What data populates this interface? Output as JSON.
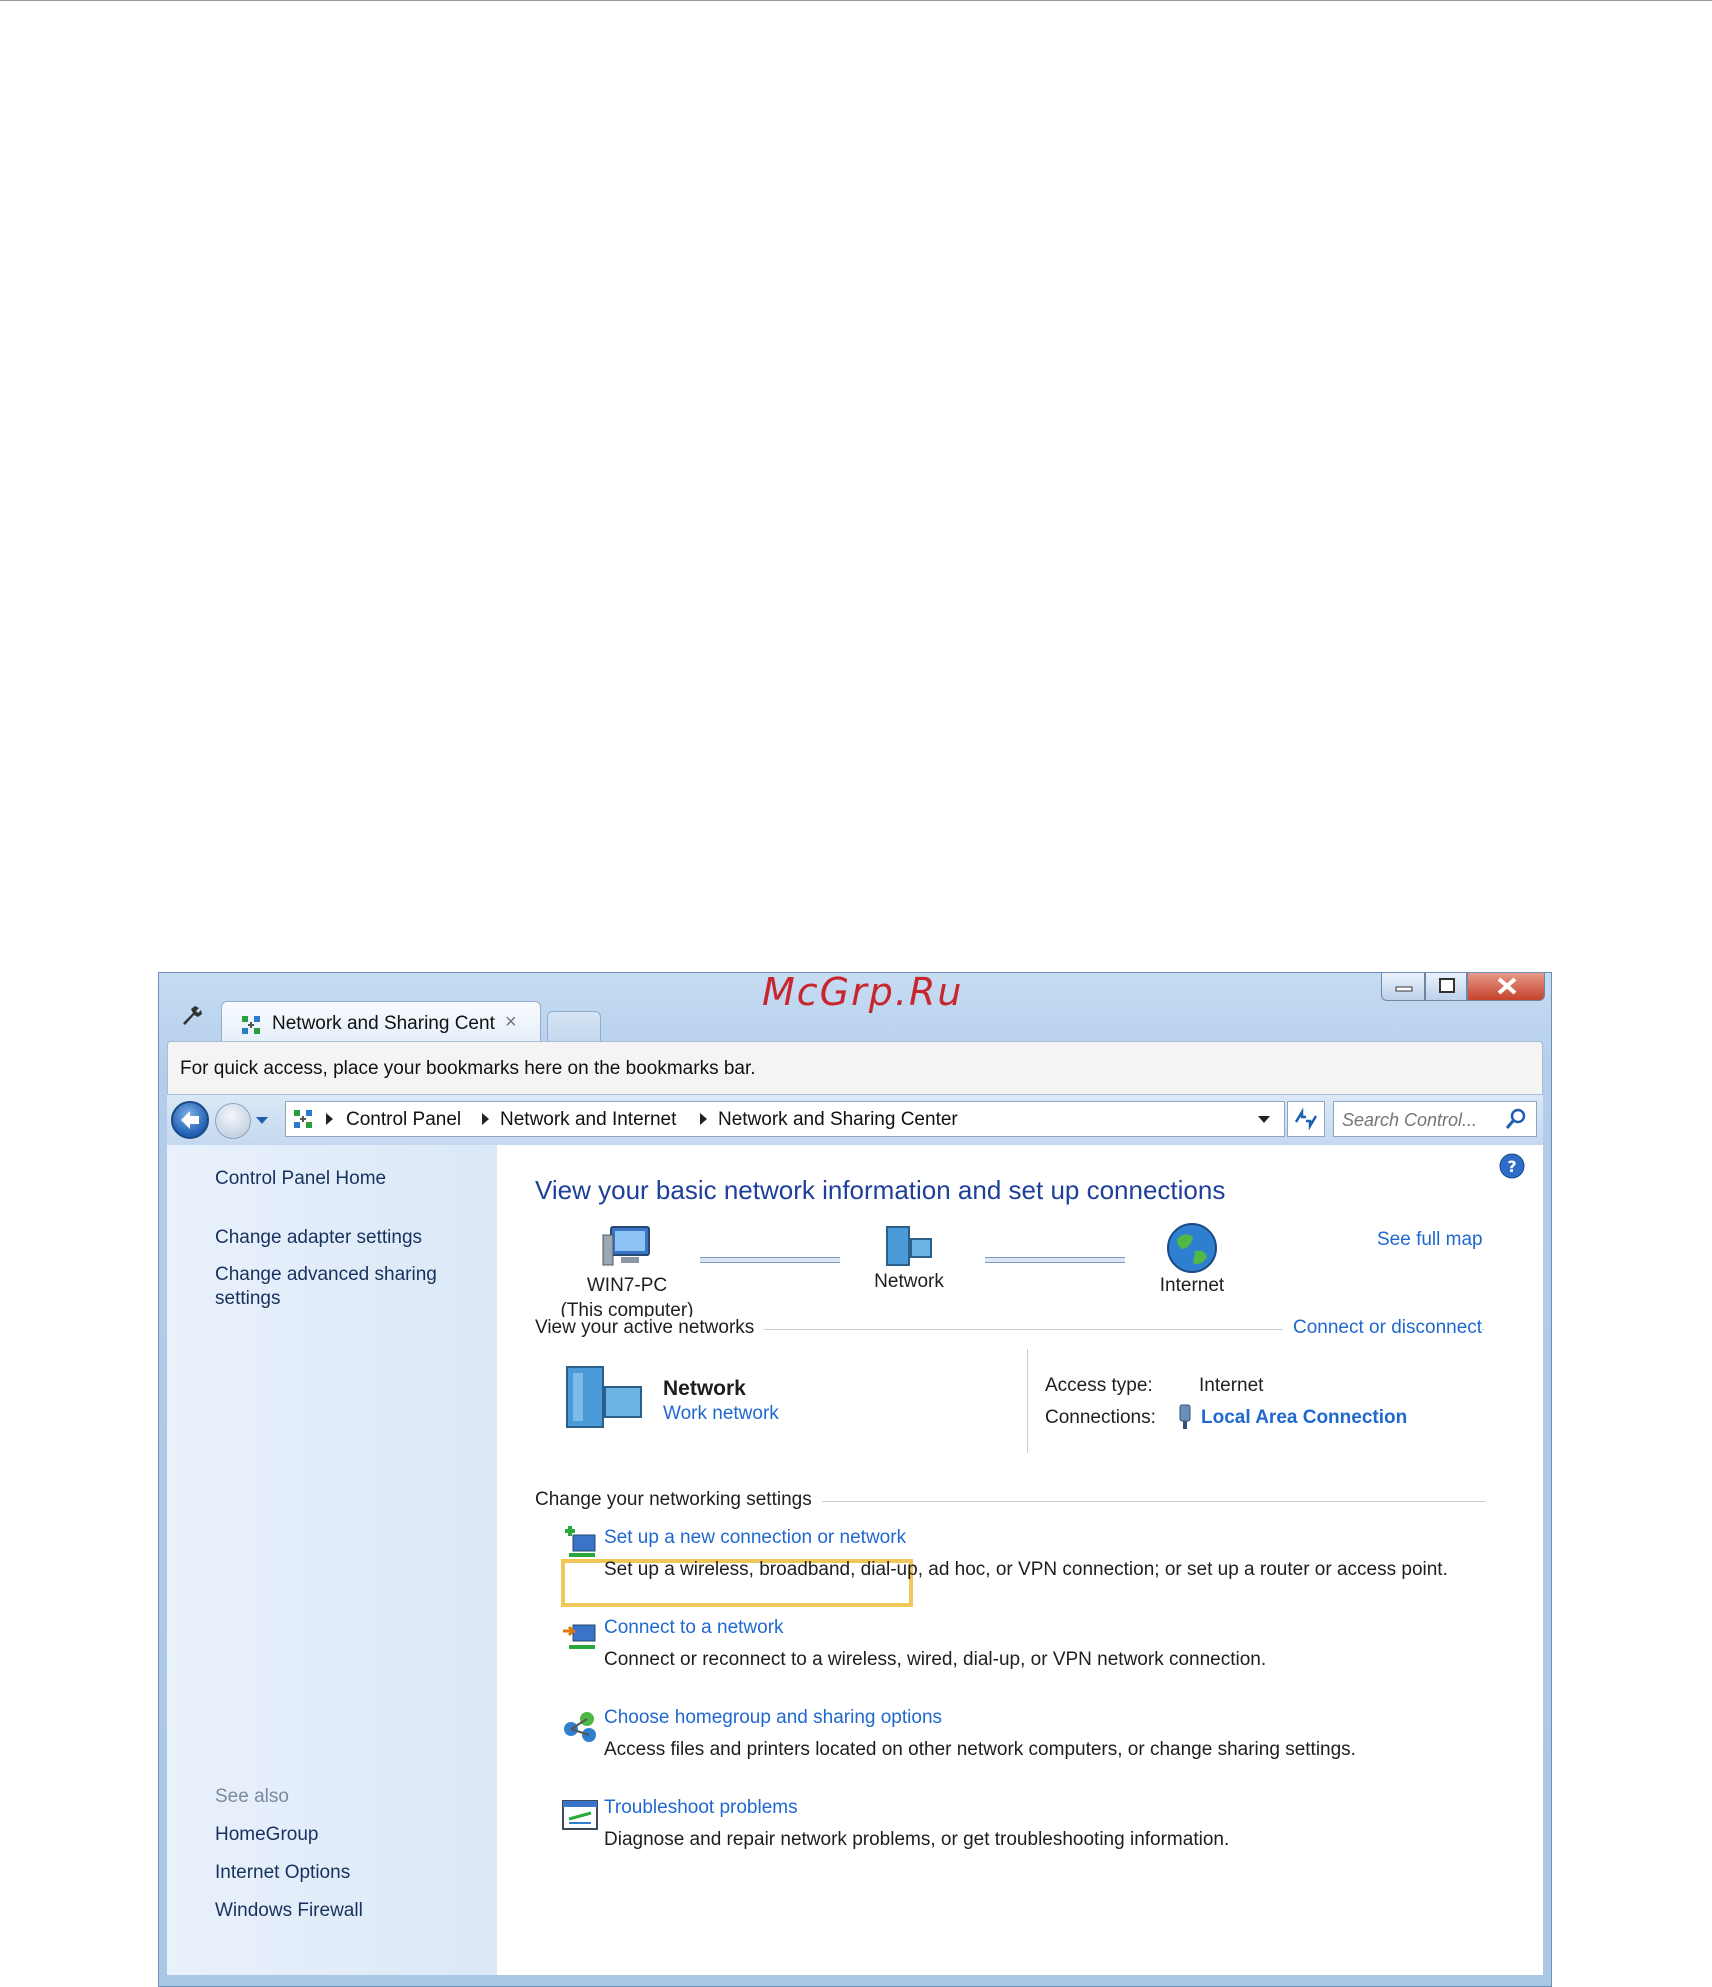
{
  "watermark": "McGrp.Ru",
  "browser": {
    "tab_title": "Network and Sharing Cent",
    "tab_close": "×",
    "bookmarks_hint": "For quick access, place your bookmarks here on the bookmarks bar."
  },
  "address": {
    "crumbs": [
      "Control Panel",
      "Network and Internet",
      "Network and Sharing Center"
    ],
    "search_placeholder": "Search Control..."
  },
  "sidebar": {
    "home": "Control Panel Home",
    "links": [
      "Change adapter settings",
      "Change advanced sharing",
      "settings"
    ],
    "see_also_label": "See also",
    "see_also": [
      "HomeGroup",
      "Internet Options",
      "Windows Firewall"
    ]
  },
  "main": {
    "title": "View your basic network information and set up connections",
    "see_full_map": "See full map",
    "map": {
      "computer_name": "WIN7-PC",
      "computer_sub": "(This computer)",
      "network": "Network",
      "internet": "Internet"
    },
    "active_networks": {
      "heading": "View your active networks",
      "connect_link": "Connect or disconnect",
      "network_name": "Network",
      "network_type": "Work network",
      "access_type_label": "Access type:",
      "access_type_value": "Internet",
      "connections_label": "Connections:",
      "connections_value": "Local Area Connection"
    },
    "change_settings": {
      "heading": "Change your networking settings",
      "tasks": [
        {
          "link": "Set up a new connection or network",
          "desc": "Set up a wireless, broadband, dial-up, ad hoc, or VPN connection; or set up a router or access point."
        },
        {
          "link": "Connect to a network",
          "desc": "Connect or reconnect to a wireless, wired, dial-up, or VPN network connection."
        },
        {
          "link": "Choose homegroup and sharing options",
          "desc": "Access files and printers located on other network computers, or change sharing settings."
        },
        {
          "link": "Troubleshoot problems",
          "desc": "Diagnose and repair network problems, or get troubleshooting information."
        }
      ]
    }
  },
  "colors": {
    "link": "#1f68d0",
    "title": "#1e3f9a",
    "highlight": "#f0c85a",
    "watermark": "#c8262e"
  }
}
